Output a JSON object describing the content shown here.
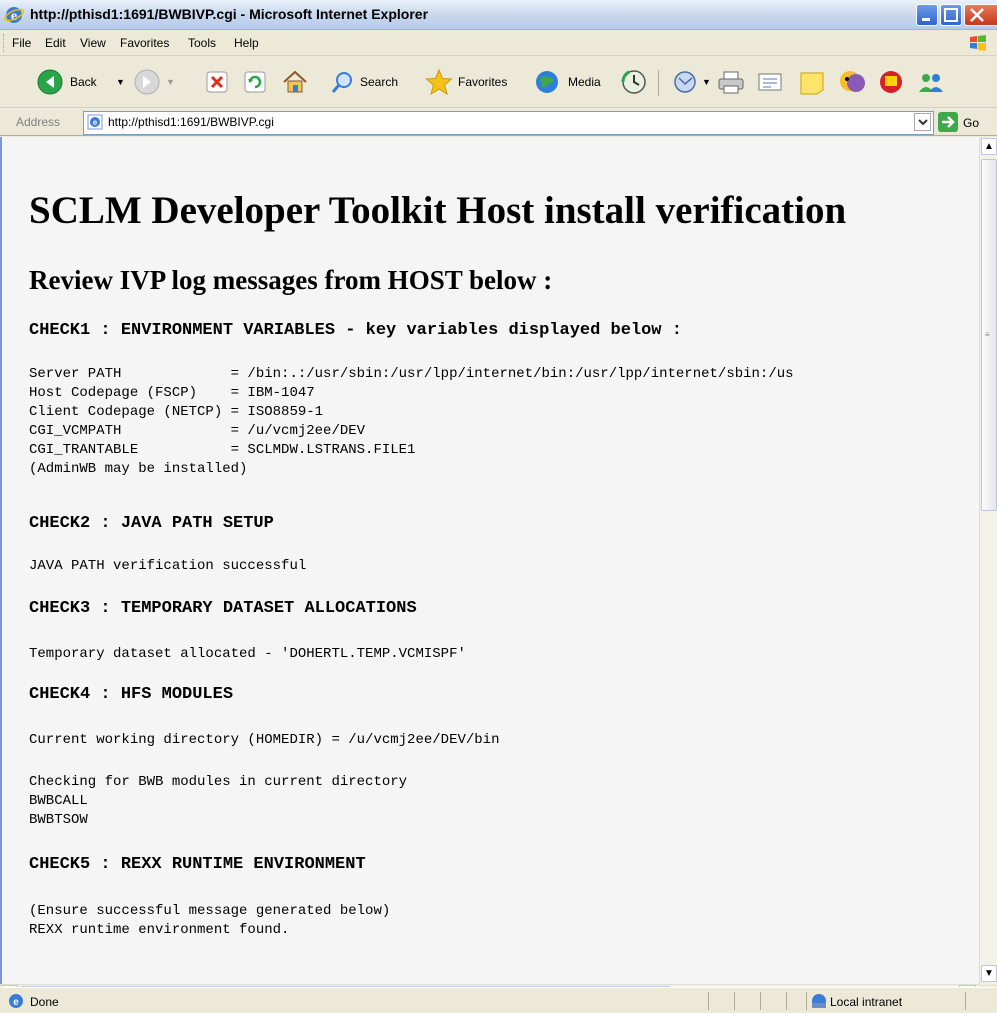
{
  "window": {
    "title": "http://pthisd1:1691/BWBIVP.cgi - Microsoft Internet Explorer"
  },
  "menu": [
    "File",
    "Edit",
    "View",
    "Favorites",
    "Tools",
    "Help"
  ],
  "toolbar": {
    "back_label": "Back",
    "search_label": "Search",
    "favorites_label": "Favorites",
    "media_label": "Media"
  },
  "address": {
    "label": "Address",
    "url": "http://pthisd1:1691/BWBIVP.cgi",
    "go_label": "Go"
  },
  "page": {
    "heading": "SCLM Developer Toolkit Host install verification",
    "subheading": "Review IVP log messages from HOST below :",
    "check1": {
      "title": "CHECK1 : ENVIRONMENT VARIABLES - key variables displayed below :",
      "lines": "Server PATH             = /bin:.:/usr/sbin:/usr/lpp/internet/bin:/usr/lpp/internet/sbin:/us\nHost Codepage (FSCP)    = IBM-1047\nClient Codepage (NETCP) = ISO8859-1\nCGI_VCMPATH             = /u/vcmj2ee/DEV\nCGI_TRANTABLE           = SCLMDW.LSTRANS.FILE1\n(AdminWB may be installed)"
    },
    "check2": {
      "title": "CHECK2 : JAVA PATH SETUP",
      "lines": "JAVA PATH verification successful"
    },
    "check3": {
      "title": "CHECK3 : TEMPORARY DATASET ALLOCATIONS",
      "lines": "Temporary dataset allocated - 'DOHERTL.TEMP.VCMISPF'"
    },
    "check4": {
      "title": "CHECK4 : HFS MODULES",
      "lines1": "Current working directory (HOMEDIR) = /u/vcmj2ee/DEV/bin",
      "lines2": "Checking for BWB modules in current directory\nBWBCALL\nBWBTSOW"
    },
    "check5": {
      "title": "CHECK5 : REXX RUNTIME ENVIRONMENT",
      "lines": "(Ensure successful message generated below)\nREXX runtime environment found."
    }
  },
  "status": {
    "text": "Done",
    "zone": "Local intranet"
  }
}
